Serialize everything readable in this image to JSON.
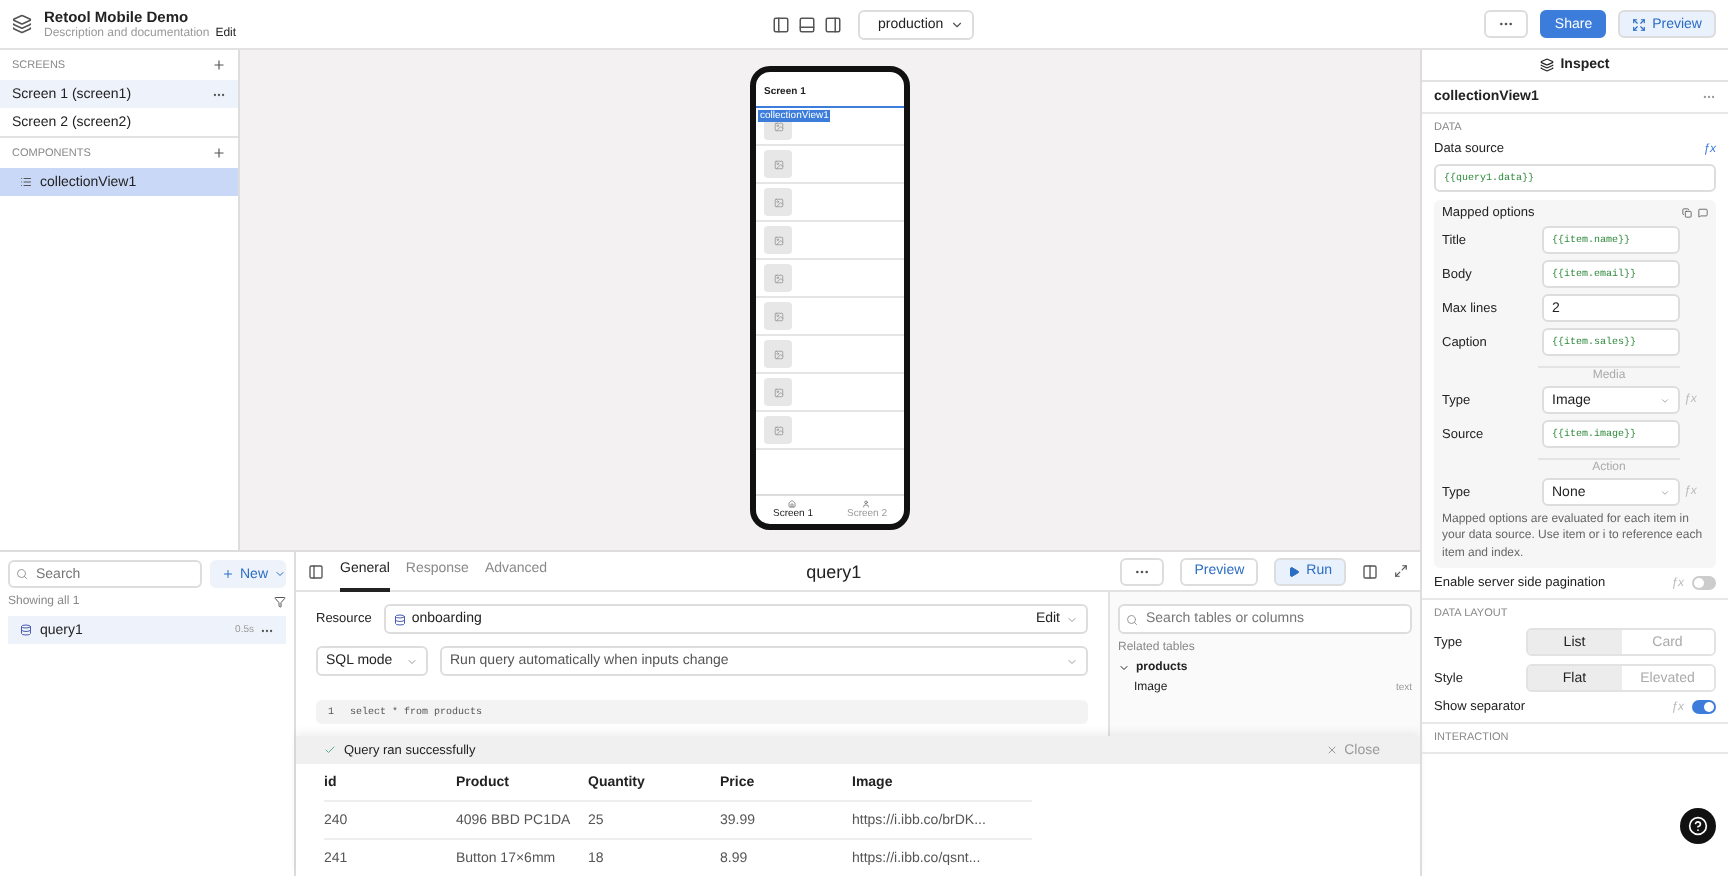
{
  "app": {
    "title": "Retool Mobile Demo",
    "subtitle": "Description and documentation",
    "edit_label": "Edit",
    "environment": "production",
    "share": "Share",
    "preview": "Preview"
  },
  "screens": {
    "heading": "SCREENS",
    "items": [
      {
        "label": "Screen 1 (screen1)",
        "selected": true
      },
      {
        "label": "Screen 2 (screen2)",
        "selected": false
      }
    ]
  },
  "components": {
    "heading": "COMPONENTS",
    "items": [
      {
        "label": "collectionView1",
        "selected": true
      }
    ]
  },
  "phone": {
    "title": "Screen 1",
    "selected_component": "collectionView1",
    "tabs": [
      {
        "label": "Screen 1",
        "selected": true
      },
      {
        "label": "Screen 2",
        "selected": false
      }
    ]
  },
  "inspector": {
    "tab": "Inspect",
    "component": "collectionView1",
    "data_heading": "DATA",
    "source_label": "Data source",
    "source_fx": "ƒx",
    "source_value": "{{query1.data}}",
    "mapped_title": "Mapped options",
    "mapped": [
      {
        "kind": "code",
        "label": "Title",
        "value": "{{item.name}}"
      },
      {
        "kind": "code",
        "label": "Body",
        "value": "{{item.email}}"
      },
      {
        "kind": "text",
        "label": "Max lines",
        "value": "2"
      },
      {
        "kind": "code",
        "label": "Caption",
        "value": "{{item.sales}}"
      },
      {
        "kind": "divider",
        "label": "Media"
      },
      {
        "kind": "select",
        "label": "Type",
        "value": "Image",
        "fx": "ƒx"
      },
      {
        "kind": "code",
        "label": "Source",
        "value": "{{item.image}}"
      },
      {
        "kind": "divider",
        "label": "Action"
      },
      {
        "kind": "select",
        "label": "Type",
        "value": "None",
        "fx": "ƒx"
      }
    ],
    "note": "Mapped options are evaluated for each item in your data source. Use item or i to reference each item and index.",
    "pagination": {
      "label": "Enable server side pagination",
      "fx": "ƒx",
      "on": false
    },
    "layout_heading": "DATA LAYOUT",
    "segments": [
      {
        "label": "Type",
        "options": [
          {
            "label": "List",
            "selected": true
          },
          {
            "label": "Card",
            "selected": false
          }
        ]
      },
      {
        "label": "Style",
        "options": [
          {
            "label": "Flat",
            "selected": true
          },
          {
            "label": "Elevated",
            "selected": false
          }
        ]
      }
    ],
    "separator": {
      "label": "Show separator",
      "fx": "ƒx",
      "on": true
    },
    "interaction_heading": "INTERACTION"
  },
  "queries": {
    "search_placeholder": "Search",
    "new_label": "New",
    "count": "Showing all 1",
    "items": [
      {
        "name": "query1",
        "time": "0.5s",
        "selected": true
      }
    ]
  },
  "editor": {
    "tabs": [
      {
        "label": "General",
        "selected": true
      },
      {
        "label": "Response",
        "selected": false
      },
      {
        "label": "Advanced",
        "selected": false
      }
    ],
    "title": "query1",
    "preview": "Preview",
    "run": "Run",
    "resource_label": "Resource",
    "resource": "onboarding",
    "resource_edit": "Edit",
    "mode": "SQL mode",
    "trigger": "Run query automatically when inputs change",
    "code": [
      {
        "number": "1",
        "text": "select * from products"
      }
    ],
    "schema_placeholder": "Search tables or columns",
    "schema_heading": "Related tables",
    "tables": [
      {
        "name": "products",
        "expanded": true,
        "columns": [
          {
            "name": "Image",
            "type": "text"
          }
        ]
      }
    ]
  },
  "results": {
    "message": "Query ran successfully",
    "close": "Close",
    "columns": [
      "id",
      "Product",
      "Quantity",
      "Price",
      "Image"
    ],
    "rows": [
      [
        "240",
        "4096 BBD PC1DA",
        "25",
        "39.99",
        "https://i.ibb.co/brDK..."
      ],
      [
        "241",
        "Button 17×6mm",
        "18",
        "8.99",
        "https://i.ibb.co/qsnt..."
      ]
    ]
  }
}
